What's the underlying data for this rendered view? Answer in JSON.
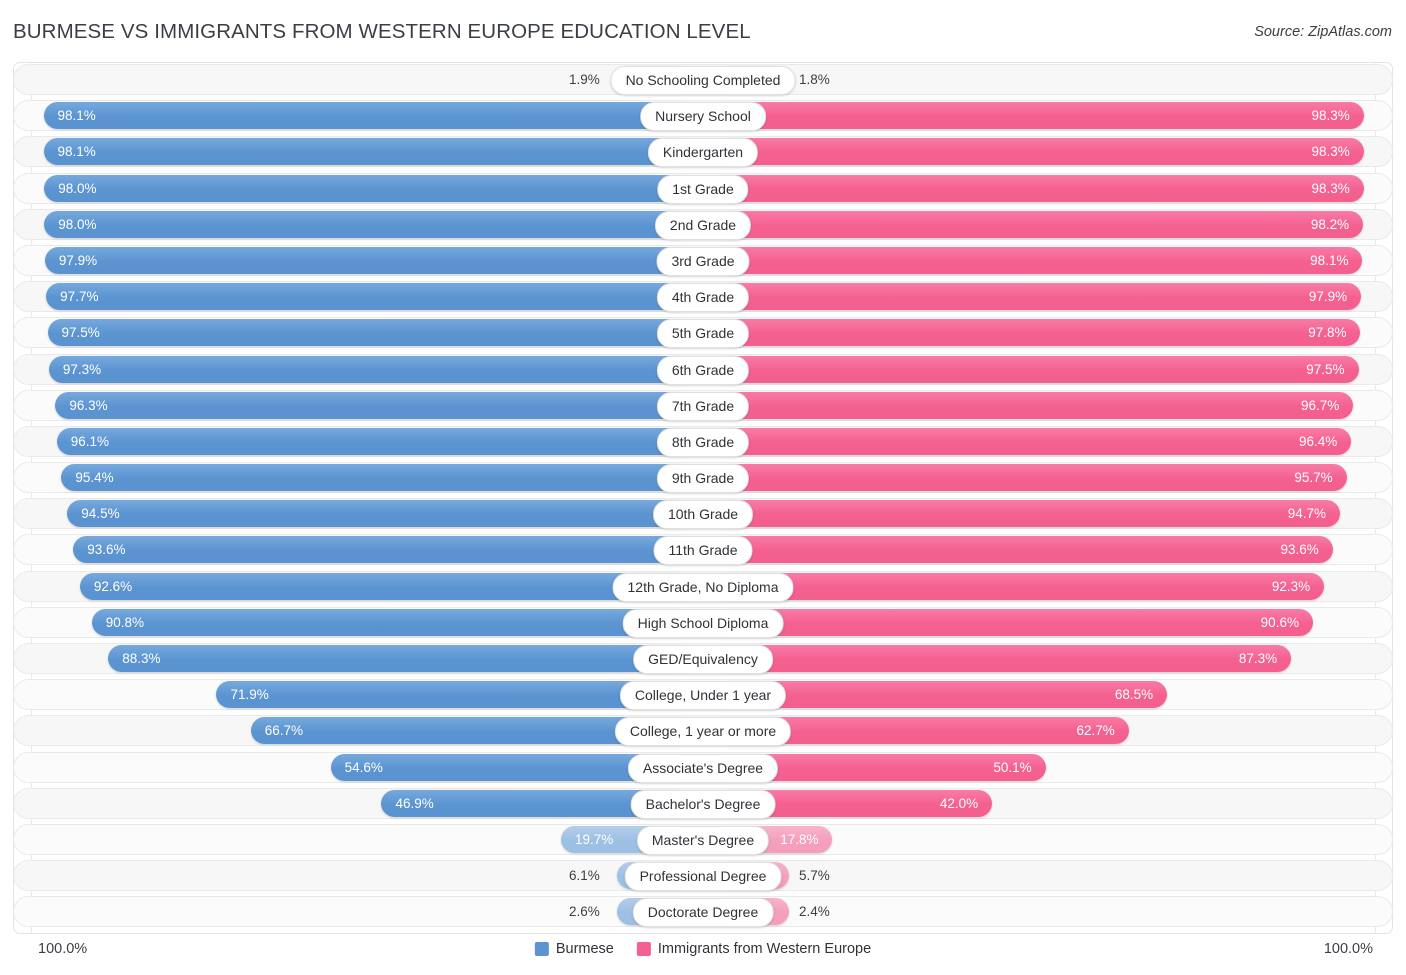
{
  "header": {
    "title": "BURMESE VS IMMIGRANTS FROM WESTERN EUROPE EDUCATION LEVEL",
    "source": "Source: ZipAtlas.com"
  },
  "footer": {
    "left_axis_max": "100.0%",
    "right_axis_max": "100.0%",
    "legend": [
      {
        "label": "Burmese",
        "color": "#5b94d1"
      },
      {
        "label": "Immigrants from Western Europe",
        "color": "#f4608f"
      }
    ]
  },
  "colors": {
    "burmese": "#5b94d1",
    "burmese_pale": "#9dc0e4",
    "western_europe": "#f4608f",
    "western_europe_pale": "#f49fbd",
    "track": "#f7f7f7",
    "text": "#3a3f45"
  },
  "chart_data": {
    "type": "bar",
    "orientation": "horizontal-diverging",
    "title": "BURMESE VS IMMIGRANTS FROM WESTERN EUROPE EDUCATION LEVEL",
    "xlabel": "",
    "ylabel": "",
    "xlim": [
      0,
      100
    ],
    "grid": false,
    "legend_position": "bottom-center",
    "categories": [
      "No Schooling Completed",
      "Nursery School",
      "Kindergarten",
      "1st Grade",
      "2nd Grade",
      "3rd Grade",
      "4th Grade",
      "5th Grade",
      "6th Grade",
      "7th Grade",
      "8th Grade",
      "9th Grade",
      "10th Grade",
      "11th Grade",
      "12th Grade, No Diploma",
      "High School Diploma",
      "GED/Equivalency",
      "College, Under 1 year",
      "College, 1 year or more",
      "Associate's Degree",
      "Bachelor's Degree",
      "Master's Degree",
      "Professional Degree",
      "Doctorate Degree"
    ],
    "series": [
      {
        "name": "Burmese",
        "color": "#5b94d1",
        "values": [
          1.9,
          98.1,
          98.1,
          98.0,
          98.0,
          97.9,
          97.7,
          97.5,
          97.3,
          96.3,
          96.1,
          95.4,
          94.5,
          93.6,
          92.6,
          90.8,
          88.3,
          71.9,
          66.7,
          54.6,
          46.9,
          19.7,
          6.1,
          2.6
        ]
      },
      {
        "name": "Immigrants from Western Europe",
        "color": "#f4608f",
        "values": [
          1.8,
          98.3,
          98.3,
          98.3,
          98.2,
          98.1,
          97.9,
          97.8,
          97.5,
          96.7,
          96.4,
          95.7,
          94.7,
          93.6,
          92.3,
          90.6,
          87.3,
          68.5,
          62.7,
          50.1,
          42.0,
          17.8,
          5.7,
          2.4
        ]
      }
    ]
  },
  "rows": [
    {
      "label": "No Schooling Completed",
      "left": "1.9%",
      "right": "1.8%",
      "lv": 1.9,
      "rv": 1.8,
      "pale": true
    },
    {
      "label": "Nursery School",
      "left": "98.1%",
      "right": "98.3%",
      "lv": 98.1,
      "rv": 98.3,
      "pale": false
    },
    {
      "label": "Kindergarten",
      "left": "98.1%",
      "right": "98.3%",
      "lv": 98.1,
      "rv": 98.3,
      "pale": false
    },
    {
      "label": "1st Grade",
      "left": "98.0%",
      "right": "98.3%",
      "lv": 98.0,
      "rv": 98.3,
      "pale": false
    },
    {
      "label": "2nd Grade",
      "left": "98.0%",
      "right": "98.2%",
      "lv": 98.0,
      "rv": 98.2,
      "pale": false
    },
    {
      "label": "3rd Grade",
      "left": "97.9%",
      "right": "98.1%",
      "lv": 97.9,
      "rv": 98.1,
      "pale": false
    },
    {
      "label": "4th Grade",
      "left": "97.7%",
      "right": "97.9%",
      "lv": 97.7,
      "rv": 97.9,
      "pale": false
    },
    {
      "label": "5th Grade",
      "left": "97.5%",
      "right": "97.8%",
      "lv": 97.5,
      "rv": 97.8,
      "pale": false
    },
    {
      "label": "6th Grade",
      "left": "97.3%",
      "right": "97.5%",
      "lv": 97.3,
      "rv": 97.5,
      "pale": false
    },
    {
      "label": "7th Grade",
      "left": "96.3%",
      "right": "96.7%",
      "lv": 96.3,
      "rv": 96.7,
      "pale": false
    },
    {
      "label": "8th Grade",
      "left": "96.1%",
      "right": "96.4%",
      "lv": 96.1,
      "rv": 96.4,
      "pale": false
    },
    {
      "label": "9th Grade",
      "left": "95.4%",
      "right": "95.7%",
      "lv": 95.4,
      "rv": 95.7,
      "pale": false
    },
    {
      "label": "10th Grade",
      "left": "94.5%",
      "right": "94.7%",
      "lv": 94.5,
      "rv": 94.7,
      "pale": false
    },
    {
      "label": "11th Grade",
      "left": "93.6%",
      "right": "93.6%",
      "lv": 93.6,
      "rv": 93.6,
      "pale": false
    },
    {
      "label": "12th Grade, No Diploma",
      "left": "92.6%",
      "right": "92.3%",
      "lv": 92.6,
      "rv": 92.3,
      "pale": false
    },
    {
      "label": "High School Diploma",
      "left": "90.8%",
      "right": "90.6%",
      "lv": 90.8,
      "rv": 90.6,
      "pale": false
    },
    {
      "label": "GED/Equivalency",
      "left": "88.3%",
      "right": "87.3%",
      "lv": 88.3,
      "rv": 87.3,
      "pale": false
    },
    {
      "label": "College, Under 1 year",
      "left": "71.9%",
      "right": "68.5%",
      "lv": 71.9,
      "rv": 68.5,
      "pale": false
    },
    {
      "label": "College, 1 year or more",
      "left": "66.7%",
      "right": "62.7%",
      "lv": 66.7,
      "rv": 62.7,
      "pale": false
    },
    {
      "label": "Associate's Degree",
      "left": "54.6%",
      "right": "50.1%",
      "lv": 54.6,
      "rv": 50.1,
      "pale": false
    },
    {
      "label": "Bachelor's Degree",
      "left": "46.9%",
      "right": "42.0%",
      "lv": 46.9,
      "rv": 42.0,
      "pale": false
    },
    {
      "label": "Master's Degree",
      "left": "19.7%",
      "right": "17.8%",
      "lv": 19.7,
      "rv": 17.8,
      "pale": true
    },
    {
      "label": "Professional Degree",
      "left": "6.1%",
      "right": "5.7%",
      "lv": 6.1,
      "rv": 5.7,
      "pale": true
    },
    {
      "label": "Doctorate Degree",
      "left": "2.6%",
      "right": "2.4%",
      "lv": 2.6,
      "rv": 2.4,
      "pale": true
    }
  ]
}
